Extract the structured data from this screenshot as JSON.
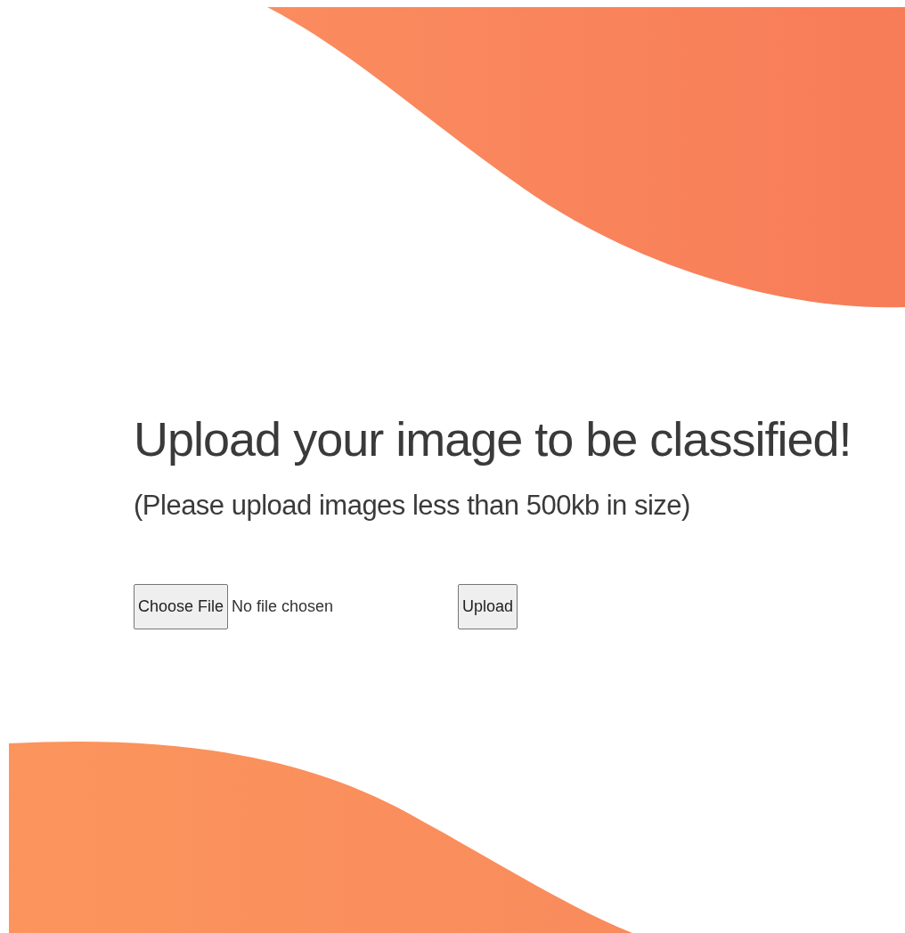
{
  "heading": "Upload your image to be classified!",
  "subheading": "(Please upload images less than 500kb in size)",
  "file_input": {
    "button": "Choose File",
    "status": "No file chosen"
  },
  "upload_button": "Upload"
}
